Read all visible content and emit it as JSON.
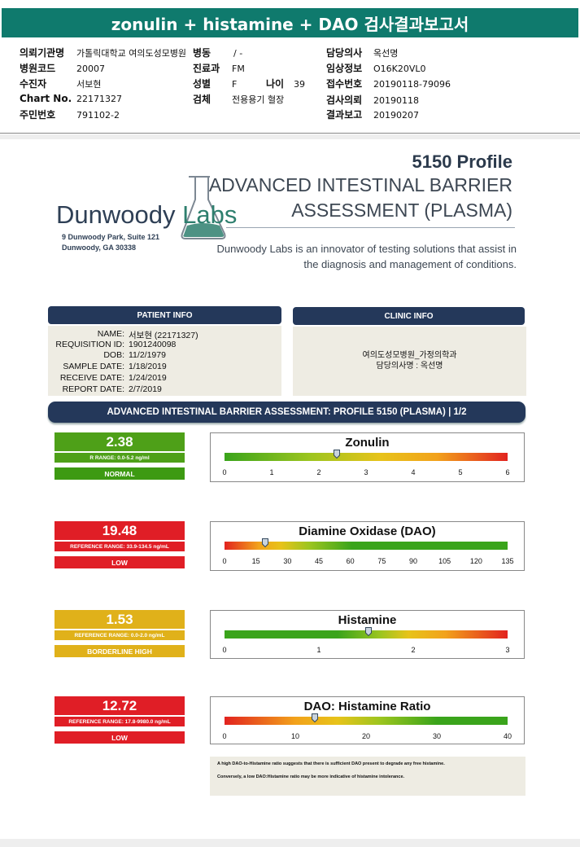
{
  "title": "zonulin + histamine + DAO 검사결과보고서",
  "header": {
    "fields": [
      {
        "label": "의뢰기관명",
        "value": "가톨릭대학교 여의도성모병원"
      },
      {
        "label": "병동",
        "value": "/ -"
      },
      {
        "label": "담당의사",
        "value": "옥선명"
      },
      {
        "label": "병원코드",
        "value": "20007"
      },
      {
        "label": "진료과",
        "value": "FM"
      },
      {
        "label": "임상정보",
        "value": "O16K20VL0"
      },
      {
        "label": "수진자",
        "value": "서보현"
      },
      {
        "label": "성별",
        "value": "F"
      },
      {
        "label": "나이",
        "value": "39"
      },
      {
        "label": "접수번호",
        "value": "20190118-79096"
      },
      {
        "label": "Chart No.",
        "value": "22171327"
      },
      {
        "label": "검체",
        "value": "전용용기 혈장"
      },
      {
        "label": "검사의뢰",
        "value": "20190118"
      },
      {
        "label": "주민번호",
        "value": "791102-2"
      },
      {
        "label": "결과보고",
        "value": "20190207"
      }
    ]
  },
  "report": {
    "profile": "5150 Profile",
    "title_line1": "ADVANCED INTESTINAL BARRIER",
    "title_line2": "ASSESSMENT (PLASMA)",
    "tagline_line1": "Dunwoody Labs is an innovator of testing solutions that assist in",
    "tagline_line2": "the diagnosis and management of conditions.",
    "logo_main": "Dunwoody",
    "logo_labs": "Labs",
    "address_line1": "9 Dunwoody Park, Suite 121",
    "address_line2": "Dunwoody, GA 30338"
  },
  "patient_info": {
    "heading": "PATIENT INFO",
    "rows": [
      {
        "key": "NAME:",
        "value": "서보현 (22171327)"
      },
      {
        "key": "REQUISITION ID:",
        "value": "1901240098"
      },
      {
        "key": "DOB:",
        "value": "11/2/1979"
      },
      {
        "key": "SAMPLE DATE:",
        "value": "1/18/2019"
      },
      {
        "key": "RECEIVE DATE:",
        "value": "1/24/2019"
      },
      {
        "key": "REPORT DATE:",
        "value": "2/7/2019"
      }
    ]
  },
  "clinic_info": {
    "heading": "CLINIC INFO",
    "line1": "여의도성모병원_가정의학과",
    "line2": "담당의사명 : 옥선명"
  },
  "section_title": "ADVANCED INTESTINAL BARRIER ASSESSMENT: PROFILE 5150 (PLASMA) | 1/2",
  "results": [
    {
      "name": "Zonulin",
      "value": "2.38",
      "range_text": "R RANGE: 0.0-5.2 ng/ml",
      "status": "NORMAL",
      "color": "#4ea018",
      "status_color": "#3d9a12",
      "scale": {
        "min": 0,
        "max": 6,
        "ticks": [
          "0",
          "1",
          "2",
          "3",
          "4",
          "5",
          "6"
        ]
      },
      "marker": 2.38,
      "gradient": [
        "#3aa41b",
        "#9cc51f",
        "#e7c31a",
        "#f2a21b",
        "#e2231f"
      ],
      "gradient_stops": [
        0,
        0.3,
        0.55,
        0.75,
        1
      ]
    },
    {
      "name": "Diamine Oxidase (DAO)",
      "value": "19.48",
      "range_text": "REFERENCE RANGE: 33.9-134.5 ng/mL",
      "status": "LOW",
      "color": "#e01e26",
      "status_color": "#e01e26",
      "scale": {
        "min": 0,
        "max": 135,
        "ticks": [
          "0",
          "15",
          "30",
          "45",
          "60",
          "75",
          "90",
          "105",
          "120",
          "135"
        ]
      },
      "marker": 19.48,
      "gradient": [
        "#e2231f",
        "#f2a21b",
        "#e7c31a",
        "#9cc51f",
        "#3aa41b",
        "#3aa41b"
      ],
      "gradient_stops": [
        0,
        0.12,
        0.2,
        0.3,
        0.45,
        1
      ]
    },
    {
      "name": "Histamine",
      "value": "1.53",
      "range_text": "REFERENCE RANGE: 0.0-2.0 ng/mL",
      "status": "BORDERLINE HIGH",
      "color": "#e0b11a",
      "status_color": "#e0b11a",
      "scale": {
        "min": 0,
        "max": 3,
        "ticks": [
          "0",
          "1",
          "2",
          "3"
        ]
      },
      "marker": 1.53,
      "gradient": [
        "#3aa41b",
        "#3aa41b",
        "#9cc51f",
        "#e7c31a",
        "#f2a21b",
        "#e2231f"
      ],
      "gradient_stops": [
        0,
        0.4,
        0.55,
        0.65,
        0.78,
        1
      ]
    },
    {
      "name": "DAO: Histamine Ratio",
      "value": "12.72",
      "range_text": "REFERENCE RANGE: 17.8-9980.0 ng/mL",
      "status": "LOW",
      "color": "#e01e26",
      "status_color": "#e01e26",
      "scale": {
        "min": 0,
        "max": 40,
        "ticks": [
          "0",
          "10",
          "20",
          "30",
          "40"
        ]
      },
      "marker": 12.72,
      "gradient": [
        "#e2231f",
        "#f2a21b",
        "#e7c31a",
        "#9cc51f",
        "#3aa41b",
        "#3aa41b"
      ],
      "gradient_stops": [
        0,
        0.25,
        0.4,
        0.55,
        0.75,
        1
      ]
    }
  ],
  "note": {
    "line1": "A high DAO-to-Histamine ratio suggests that there is sufficient DAO present to degrade any free histamine.",
    "line2": "Conversely, a low DAO:Histamine ratio may be more indicative of histamine intolerance."
  }
}
